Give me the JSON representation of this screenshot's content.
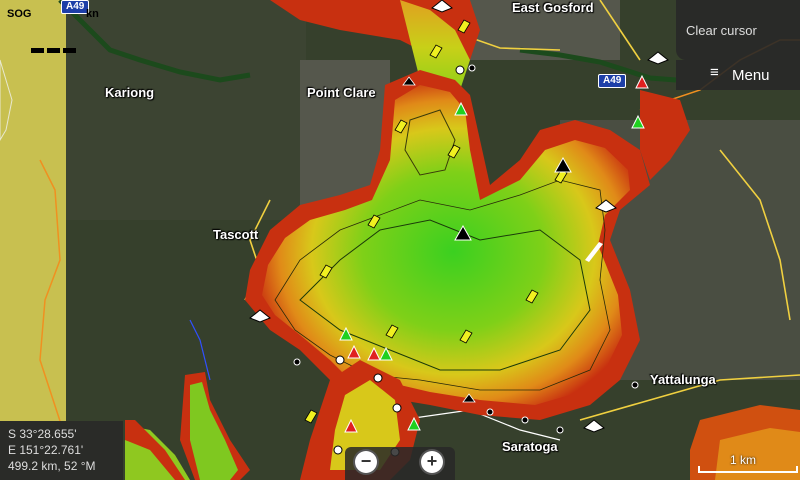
{
  "places": {
    "east_gosford": "East Gosford",
    "kariong": "Kariong",
    "point_clare": "Point Clare",
    "tascott": "Tascott",
    "yattalunga": "Yattalunga",
    "saratoga": "Saratoga"
  },
  "road_shields": {
    "top": "A49",
    "right": "A49"
  },
  "sog": {
    "label": "SOG",
    "unit": "kn"
  },
  "buttons": {
    "clear_cursor": "Clear cursor",
    "menu": "Menu",
    "zoom_out": "−",
    "zoom_in": "+"
  },
  "cursor_info": {
    "latitude": "S  33°28.655'",
    "longitude": "E 151°22.761'",
    "range_bearing": "499.2 km, 52 °M"
  },
  "scale": {
    "label": "1 km"
  },
  "colors": {
    "shallow": "#c41a0c",
    "mid": "#e0a020",
    "deep": "#3cc820",
    "land": "#36402c",
    "menu_bg": "#282828"
  }
}
